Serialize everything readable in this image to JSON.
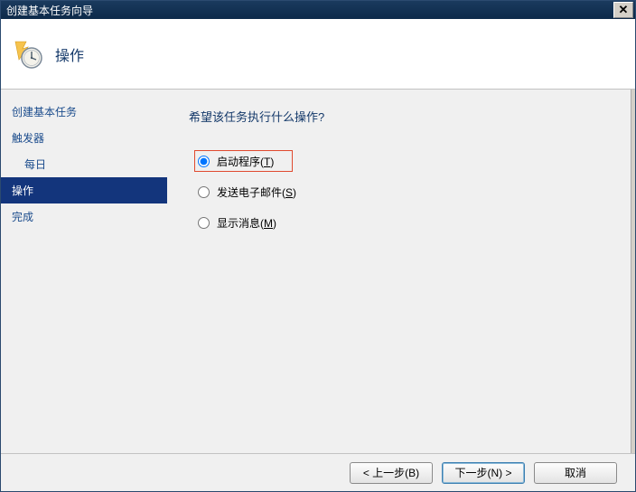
{
  "window": {
    "title": "创建基本任务向导",
    "close": "✕"
  },
  "header": {
    "title": "操作"
  },
  "sidebar": {
    "items": [
      {
        "label": "创建基本任务",
        "indent": false,
        "selected": false
      },
      {
        "label": "触发器",
        "indent": false,
        "selected": false
      },
      {
        "label": "每日",
        "indent": true,
        "selected": false
      },
      {
        "label": "操作",
        "indent": false,
        "selected": true
      },
      {
        "label": "完成",
        "indent": false,
        "selected": false
      }
    ]
  },
  "content": {
    "prompt": "希望该任务执行什么操作?",
    "options": [
      {
        "label": "启动程序",
        "mnemonic": "T",
        "checked": true,
        "highlight": true
      },
      {
        "label": "发送电子邮件",
        "mnemonic": "S",
        "checked": false,
        "highlight": false
      },
      {
        "label": "显示消息",
        "mnemonic": "M",
        "checked": false,
        "highlight": false
      }
    ]
  },
  "footer": {
    "back": "< 上一步(B)",
    "next": "下一步(N) >",
    "cancel": "取消"
  }
}
